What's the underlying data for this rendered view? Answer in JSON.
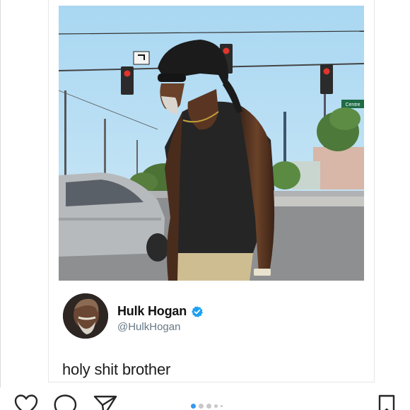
{
  "tweet": {
    "author_name": "Hulk Hogan",
    "author_handle": "@HulkHogan",
    "text": "holy shit brother",
    "verified": true
  },
  "photo": {
    "street_sign_text": "Centre"
  },
  "carousel": {
    "slide_count": 5,
    "active_index": 0,
    "accent_color": "#3897f0"
  },
  "actions": {
    "icons": [
      "heart-icon",
      "comment-icon",
      "share-icon",
      "bookmark-icon"
    ]
  }
}
